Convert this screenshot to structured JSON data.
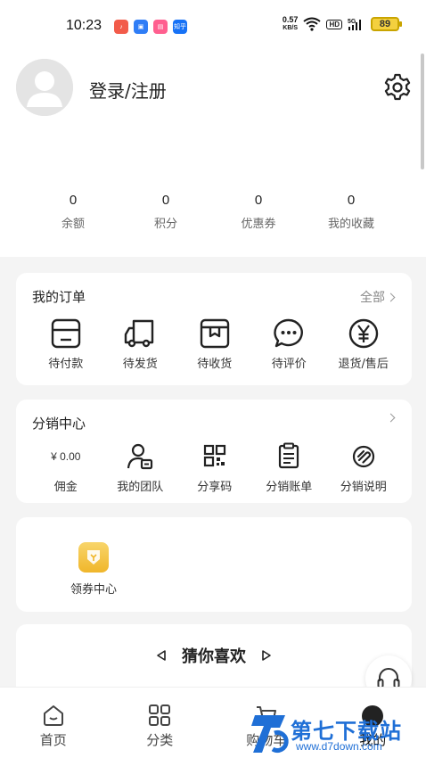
{
  "status_bar": {
    "time": "10:23",
    "app_icons": [
      {
        "name": "red-app-icon",
        "color": "#f25b4a"
      },
      {
        "name": "blue-app-icon",
        "color": "#2f7df6"
      },
      {
        "name": "pink-app-icon",
        "color": "#ff5f8f"
      },
      {
        "name": "zhihu-icon",
        "color": "#1772f6",
        "text": "知乎"
      }
    ],
    "net_speed": "0.57",
    "net_unit": "KB/S",
    "hd": "HD",
    "signal": "5G",
    "battery": "89"
  },
  "profile": {
    "login_label": "登录/注册"
  },
  "stats": [
    {
      "value": "0",
      "label": "余额"
    },
    {
      "value": "0",
      "label": "积分"
    },
    {
      "value": "0",
      "label": "优惠券"
    },
    {
      "value": "0",
      "label": "我的收藏"
    }
  ],
  "orders": {
    "title": "我的订单",
    "more": "全部",
    "items": [
      {
        "label": "待付款",
        "icon": "wallet-icon"
      },
      {
        "label": "待发货",
        "icon": "truck-icon"
      },
      {
        "label": "待收货",
        "icon": "package-icon"
      },
      {
        "label": "待评价",
        "icon": "chat-icon"
      },
      {
        "label": "退货/售后",
        "icon": "yen-icon"
      }
    ]
  },
  "distribution": {
    "title": "分销中心",
    "commission_value": "¥ 0.00",
    "items": [
      {
        "label": "佣金"
      },
      {
        "label": "我的团队",
        "icon": "team-icon"
      },
      {
        "label": "分享码",
        "icon": "qr-code-icon"
      },
      {
        "label": "分销账单",
        "icon": "bill-icon"
      },
      {
        "label": "分销说明",
        "icon": "info-icon"
      }
    ]
  },
  "coupon": {
    "label": "领券中心"
  },
  "guess": {
    "title": "猜你喜欢"
  },
  "bottom_nav": [
    {
      "label": "首页"
    },
    {
      "label": "分类"
    },
    {
      "label": "购物车"
    },
    {
      "label": "我的"
    }
  ],
  "watermark": {
    "text": "第七下载站",
    "url": "www.d7down.com"
  }
}
